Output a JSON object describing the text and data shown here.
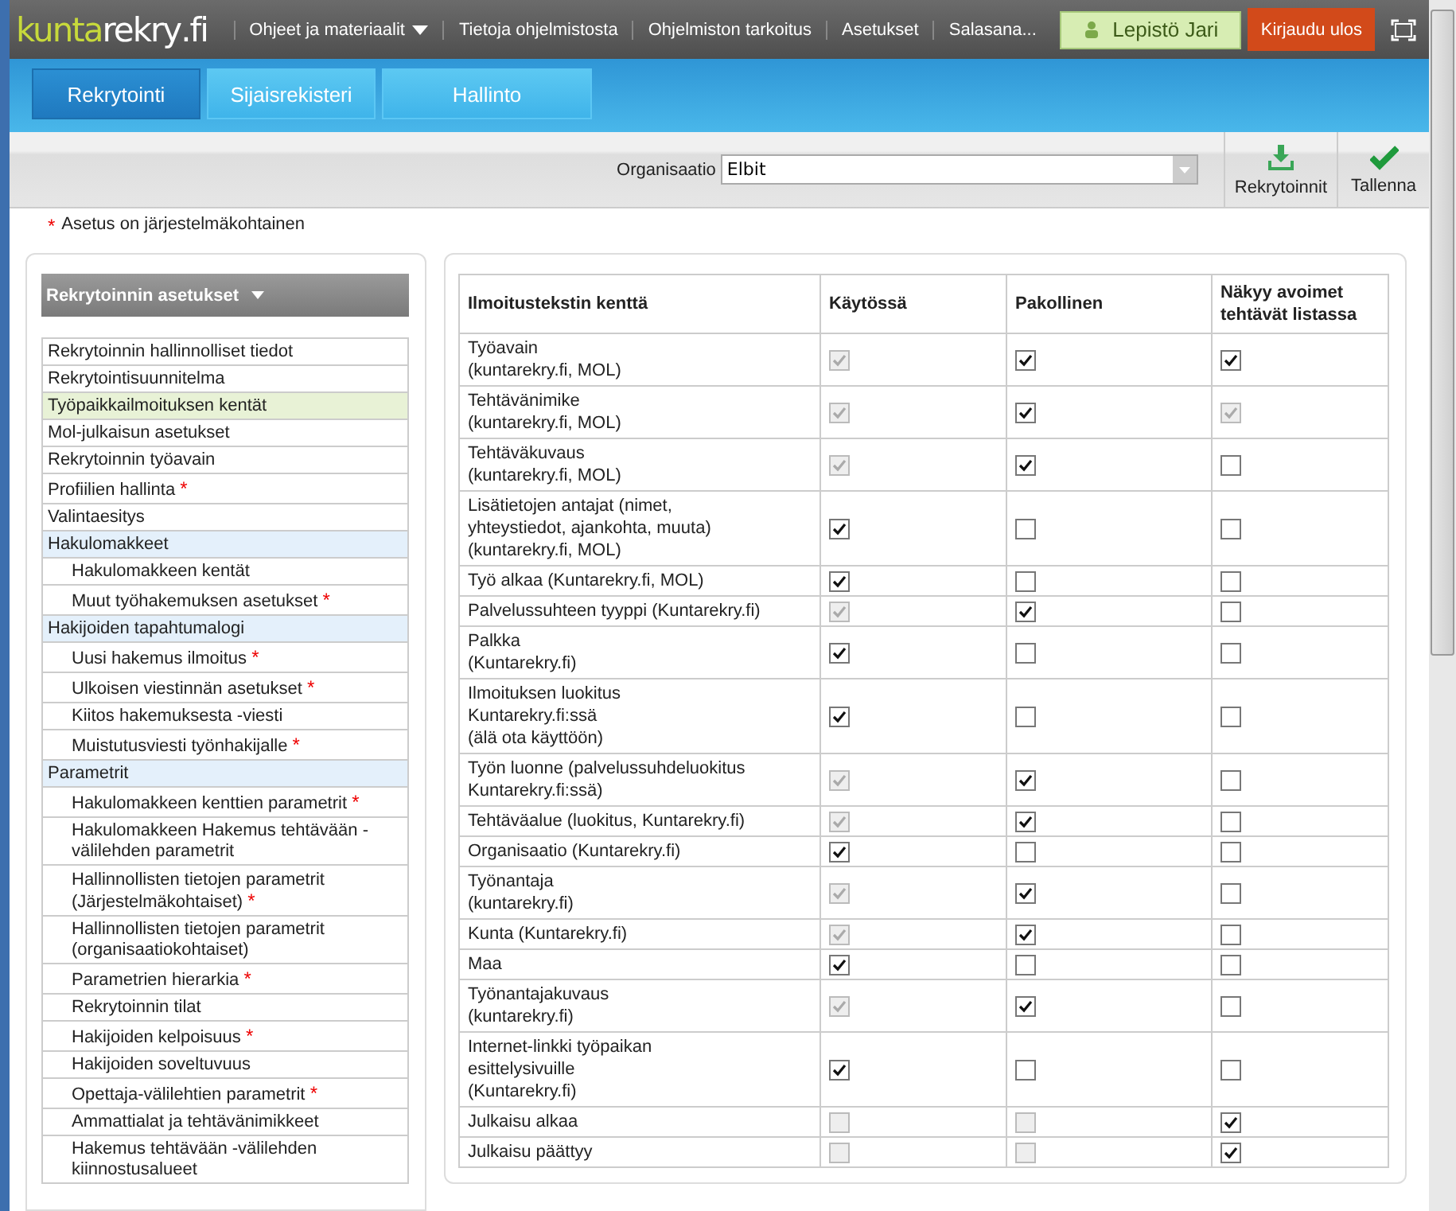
{
  "logo": [
    "kunta",
    "rekry",
    ".fi"
  ],
  "top_menu": [
    {
      "label": "Ohjeet ja materiaalit",
      "dropdown": true
    },
    {
      "label": "Tietoja ohjelmistosta",
      "dropdown": false
    },
    {
      "label": "Ohjelmiston tarkoitus",
      "dropdown": false
    },
    {
      "label": "Asetukset",
      "dropdown": false
    },
    {
      "label": "Salasana...",
      "dropdown": false
    }
  ],
  "user": "Lepistö Jari",
  "logout": "Kirjaudu ulos",
  "tabs": [
    {
      "label": "Rekrytointi",
      "selected": true
    },
    {
      "label": "Sijaisrekisteri",
      "selected": false
    },
    {
      "label": "Hallinto",
      "selected": false
    }
  ],
  "organisation": {
    "label": "Organisaatio",
    "value": "Elbit"
  },
  "toolbar": [
    {
      "label": "Rekrytoinnit",
      "kind": "download"
    },
    {
      "label": "Tallenna",
      "kind": "save"
    }
  ],
  "note": {
    "mark": "*",
    "text": "Asetus on järjestelmäkohtainen"
  },
  "sidebar": {
    "title": "Rekrytoinnin asetukset",
    "items": [
      {
        "label": "Rekrytoinnin hallinnolliset tiedot",
        "kind": "item",
        "selected": false
      },
      {
        "label": "Rekrytointisuunnitelma",
        "kind": "item",
        "selected": false
      },
      {
        "label": "Työpaikkailmoituksen kentät",
        "kind": "item",
        "selected": true
      },
      {
        "label": "Mol-julkaisun asetukset",
        "kind": "item",
        "selected": false
      },
      {
        "label": "Rekrytoinnin työavain",
        "kind": "item",
        "selected": false
      },
      {
        "label": "Profiilien hallinta",
        "kind": "item",
        "selected": false,
        "mark": "*"
      },
      {
        "label": "Valintaesitys",
        "kind": "item",
        "selected": false
      },
      {
        "label": "Hakulomakkeet",
        "kind": "group",
        "selected": false
      },
      {
        "label": "Hakulomakkeen kentät",
        "kind": "sub",
        "selected": false
      },
      {
        "label": "Muut työhakemuksen asetukset",
        "kind": "sub",
        "selected": false,
        "mark": "*"
      },
      {
        "label": "Hakijoiden tapahtumalogi",
        "kind": "group",
        "selected": false
      },
      {
        "label": "Uusi hakemus ilmoitus",
        "kind": "sub",
        "selected": false,
        "mark": "*"
      },
      {
        "label": "Ulkoisen viestinnän asetukset",
        "kind": "sub",
        "selected": false,
        "mark": "*"
      },
      {
        "label": "Kiitos hakemuksesta -viesti",
        "kind": "sub",
        "selected": false
      },
      {
        "label": "Muistutusviesti työnhakijalle",
        "kind": "sub",
        "selected": false,
        "mark": "*"
      },
      {
        "label": "Parametrit",
        "kind": "group",
        "selected": false
      },
      {
        "label": "Hakulomakkeen kenttien parametrit",
        "kind": "sub",
        "selected": false,
        "mark": "*"
      },
      {
        "label": "Hakulomakkeen Hakemus tehtävään -välilehden parametrit",
        "kind": "sub",
        "selected": false
      },
      {
        "label": "Hallinnollisten tietojen parametrit (Järjestelmäkohtaiset)",
        "kind": "sub",
        "selected": false,
        "mark": "*"
      },
      {
        "label": "Hallinnollisten tietojen parametrit (organisaatiokohtaiset)",
        "kind": "sub",
        "selected": false
      },
      {
        "label": "Parametrien hierarkia",
        "kind": "sub",
        "selected": false,
        "mark": "*"
      },
      {
        "label": "Rekrytoinnin tilat",
        "kind": "sub",
        "selected": false
      },
      {
        "label": "Hakijoiden kelpoisuus",
        "kind": "sub",
        "selected": false,
        "mark": "*"
      },
      {
        "label": "Hakijoiden soveltuvuus",
        "kind": "sub",
        "selected": false
      },
      {
        "label": "Opettaja-välilehtien parametrit",
        "kind": "sub",
        "selected": false,
        "mark": "*"
      },
      {
        "label": "Ammattialat ja tehtävänimikkeet",
        "kind": "sub",
        "selected": false
      },
      {
        "label": "Hakemus tehtävään -välilehden kiinnostusalueet",
        "kind": "sub",
        "selected": false
      }
    ]
  },
  "table": {
    "columns": [
      "Ilmoitustekstin kenttä",
      "Käytössä",
      "Pakollinen",
      "Näkyy avoimet tehtävät listassa"
    ],
    "rows": [
      {
        "field": "Työavain\n(kuntarekry.fi, MOL)",
        "cells": [
          {
            "checked": true,
            "disabled": true
          },
          {
            "checked": true,
            "disabled": false
          },
          {
            "checked": true,
            "disabled": false
          }
        ]
      },
      {
        "field": "Tehtävänimike\n(kuntarekry.fi, MOL)",
        "cells": [
          {
            "checked": true,
            "disabled": true
          },
          {
            "checked": true,
            "disabled": false
          },
          {
            "checked": true,
            "disabled": true
          }
        ]
      },
      {
        "field": "Tehtäväkuvaus\n(kuntarekry.fi, MOL)",
        "cells": [
          {
            "checked": true,
            "disabled": true
          },
          {
            "checked": true,
            "disabled": false
          },
          {
            "checked": false,
            "disabled": false
          }
        ]
      },
      {
        "field": "Lisätietojen antajat (nimet,\nyhteystiedot, ajankohta, muuta)\n(kuntarekry.fi, MOL)",
        "cells": [
          {
            "checked": true,
            "disabled": false
          },
          {
            "checked": false,
            "disabled": false
          },
          {
            "checked": false,
            "disabled": false
          }
        ]
      },
      {
        "field": "Työ alkaa (Kuntarekry.fi, MOL)",
        "cells": [
          {
            "checked": true,
            "disabled": false
          },
          {
            "checked": false,
            "disabled": false
          },
          {
            "checked": false,
            "disabled": false
          }
        ]
      },
      {
        "field": "Palvelussuhteen tyyppi (Kuntarekry.fi)",
        "cells": [
          {
            "checked": true,
            "disabled": true
          },
          {
            "checked": true,
            "disabled": false
          },
          {
            "checked": false,
            "disabled": false
          }
        ]
      },
      {
        "field": "Palkka\n(Kuntarekry.fi)",
        "cells": [
          {
            "checked": true,
            "disabled": false
          },
          {
            "checked": false,
            "disabled": false
          },
          {
            "checked": false,
            "disabled": false
          }
        ]
      },
      {
        "field": "Ilmoituksen luokitus\nKuntarekry.fi:ssä\n(älä ota käyttöön)",
        "cells": [
          {
            "checked": true,
            "disabled": false
          },
          {
            "checked": false,
            "disabled": false
          },
          {
            "checked": false,
            "disabled": false
          }
        ]
      },
      {
        "field": "Työn luonne (palvelussuhdeluokitus\nKuntarekry.fi:ssä)",
        "cells": [
          {
            "checked": true,
            "disabled": true
          },
          {
            "checked": true,
            "disabled": false
          },
          {
            "checked": false,
            "disabled": false
          }
        ]
      },
      {
        "field": "Tehtäväalue (luokitus, Kuntarekry.fi)",
        "cells": [
          {
            "checked": true,
            "disabled": true
          },
          {
            "checked": true,
            "disabled": false
          },
          {
            "checked": false,
            "disabled": false
          }
        ]
      },
      {
        "field": "Organisaatio (Kuntarekry.fi)",
        "cells": [
          {
            "checked": true,
            "disabled": false
          },
          {
            "checked": false,
            "disabled": false
          },
          {
            "checked": false,
            "disabled": false
          }
        ]
      },
      {
        "field": "Työnantaja\n(kuntarekry.fi)",
        "cells": [
          {
            "checked": true,
            "disabled": true
          },
          {
            "checked": true,
            "disabled": false
          },
          {
            "checked": false,
            "disabled": false
          }
        ]
      },
      {
        "field": "Kunta (Kuntarekry.fi)",
        "cells": [
          {
            "checked": true,
            "disabled": true
          },
          {
            "checked": true,
            "disabled": false
          },
          {
            "checked": false,
            "disabled": false
          }
        ]
      },
      {
        "field": "Maa",
        "cells": [
          {
            "checked": true,
            "disabled": false
          },
          {
            "checked": false,
            "disabled": false
          },
          {
            "checked": false,
            "disabled": false
          }
        ]
      },
      {
        "field": "Työnantajakuvaus\n(kuntarekry.fi)",
        "cells": [
          {
            "checked": true,
            "disabled": true
          },
          {
            "checked": true,
            "disabled": false
          },
          {
            "checked": false,
            "disabled": false
          }
        ]
      },
      {
        "field": "Internet-linkki työpaikan\nesittelysivuille\n(Kuntarekry.fi)",
        "cells": [
          {
            "checked": true,
            "disabled": false
          },
          {
            "checked": false,
            "disabled": false
          },
          {
            "checked": false,
            "disabled": false
          }
        ]
      },
      {
        "field": "Julkaisu alkaa",
        "cells": [
          {
            "checked": false,
            "disabled": true
          },
          {
            "checked": false,
            "disabled": true
          },
          {
            "checked": true,
            "disabled": false
          }
        ]
      },
      {
        "field": "Julkaisu päättyy",
        "cells": [
          {
            "checked": false,
            "disabled": true
          },
          {
            "checked": false,
            "disabled": true
          },
          {
            "checked": true,
            "disabled": false
          }
        ]
      }
    ]
  }
}
